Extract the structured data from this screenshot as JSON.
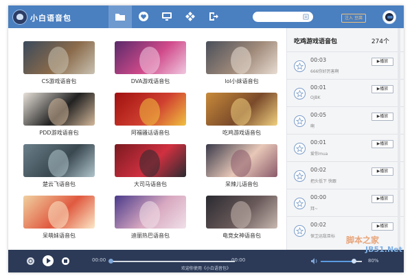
{
  "app": {
    "title": "小白语音包",
    "login_label": "注入 豆腐"
  },
  "nav": {
    "icons": [
      "folder-icon",
      "heart-icon",
      "monitor-icon",
      "gamepad-icon",
      "exit-icon"
    ]
  },
  "grid": {
    "cards": [
      {
        "label": "CS游戏语音包",
        "colors": [
          "#3a4a5c",
          "#8a6a4a",
          "#c9c2b2"
        ]
      },
      {
        "label": "DVA游戏语音包",
        "colors": [
          "#5a2a6a",
          "#d04a8a",
          "#f0c8e0"
        ]
      },
      {
        "label": "lol小妹语音包",
        "colors": [
          "#4a4f5a",
          "#a08a7a",
          "#e8dcd2"
        ]
      },
      {
        "label": "PDD游戏语音包",
        "colors": [
          "#e8e2da",
          "#222222",
          "#d4b89a"
        ]
      },
      {
        "label": "阿福骚话语音包",
        "colors": [
          "#a01010",
          "#d04030",
          "#f0c040"
        ]
      },
      {
        "label": "吃鸡游戏语音包",
        "colors": [
          "#c88a3a",
          "#7a4a2a",
          "#f0d080"
        ]
      },
      {
        "label": "楚云飞语音包",
        "colors": [
          "#6a7f8a",
          "#3a4850",
          "#b0c4cc"
        ]
      },
      {
        "label": "大司马语音包",
        "colors": [
          "#7a1a20",
          "#d03040",
          "#2a2a30"
        ]
      },
      {
        "label": "呆辣儿语音包",
        "colors": [
          "#3a3a4a",
          "#e8c8b8",
          "#8a5a6a"
        ]
      },
      {
        "label": "呆萌妹语音包",
        "colors": [
          "#f0d0a0",
          "#e05a40",
          "#fce8c8"
        ]
      },
      {
        "label": "迪丽热巴语音包",
        "colors": [
          "#4a3a8a",
          "#d8a8c0",
          "#f0e0e8"
        ]
      },
      {
        "label": "电竞女神语音包",
        "colors": [
          "#2a2a30",
          "#6a5a5a",
          "#c8b8b0"
        ]
      }
    ]
  },
  "sidebar": {
    "title": "吃鸡游戏语音包",
    "count": "274个",
    "play_label": "▶播放",
    "rows": [
      {
        "time": "00:03",
        "desc": "666你好厉害啊"
      },
      {
        "time": "00:01",
        "desc": "OJBK"
      },
      {
        "time": "00:05",
        "desc": "啊"
      },
      {
        "time": "00:01",
        "desc": "爱你mua"
      },
      {
        "time": "00:02",
        "desc": "把头低下 快跟"
      },
      {
        "time": "00:00",
        "desc": "拜~"
      },
      {
        "time": "00:02",
        "desc": "保卫运敌目标"
      }
    ]
  },
  "player": {
    "current_time": "00:00",
    "total_time": "00:00",
    "now_playing": "欢迎你使用《小白语音包》",
    "progress": 0,
    "volume": 0.8,
    "volume_label": "80%"
  },
  "watermark": {
    "line1": "脚本之家",
    "line2": "JB51.Net"
  },
  "colors": {
    "topbar": "#4a7fc0",
    "bottombar": "#2c3a57",
    "accent": "#5b9be0",
    "login": "#f0c27a"
  }
}
